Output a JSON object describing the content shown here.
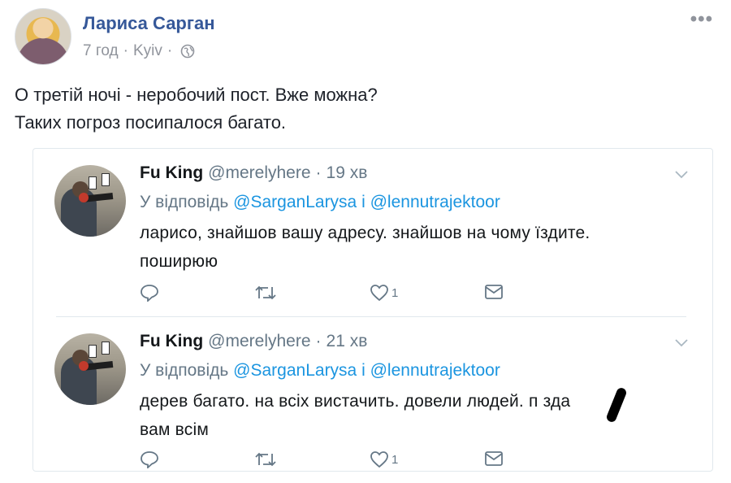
{
  "post": {
    "author": "Лариса Сарган",
    "time": "7 год",
    "location": "Kyiv",
    "meta_separator": "·",
    "more_icon": "more-horizontal-icon",
    "text_lines": [
      "О третій ночі - неробочий пост. Вже можна?",
      "Таких погроз посипалося багато."
    ]
  },
  "tweets": [
    {
      "name": "Fu King",
      "handle": "@merelyhere",
      "dot": "·",
      "time": "19 хв",
      "reply_prefix": "У відповідь",
      "mention_1": "@SarganLarysa",
      "conj": "і",
      "mention_2": "@lennutrajektoor",
      "body_lines": [
        "ларисо, знайшов вашу адресу. знайшов на чому їздите.",
        "поширюю"
      ],
      "likes": "1"
    },
    {
      "name": "Fu King",
      "handle": "@merelyhere",
      "dot": "·",
      "time": "21 хв",
      "reply_prefix": "У відповідь",
      "mention_1": "@SarganLarysa",
      "conj": "і",
      "mention_2": "@lennutrajektoor",
      "body_lines": [
        "дерев багато. на всіх вистачить. довели людей. п  зда",
        "вам всім"
      ],
      "likes": "1"
    }
  ],
  "colors": {
    "fb_link": "#365899",
    "tw_link": "#1b95e0",
    "muted": "#657786",
    "border": "#e1e8ed"
  }
}
